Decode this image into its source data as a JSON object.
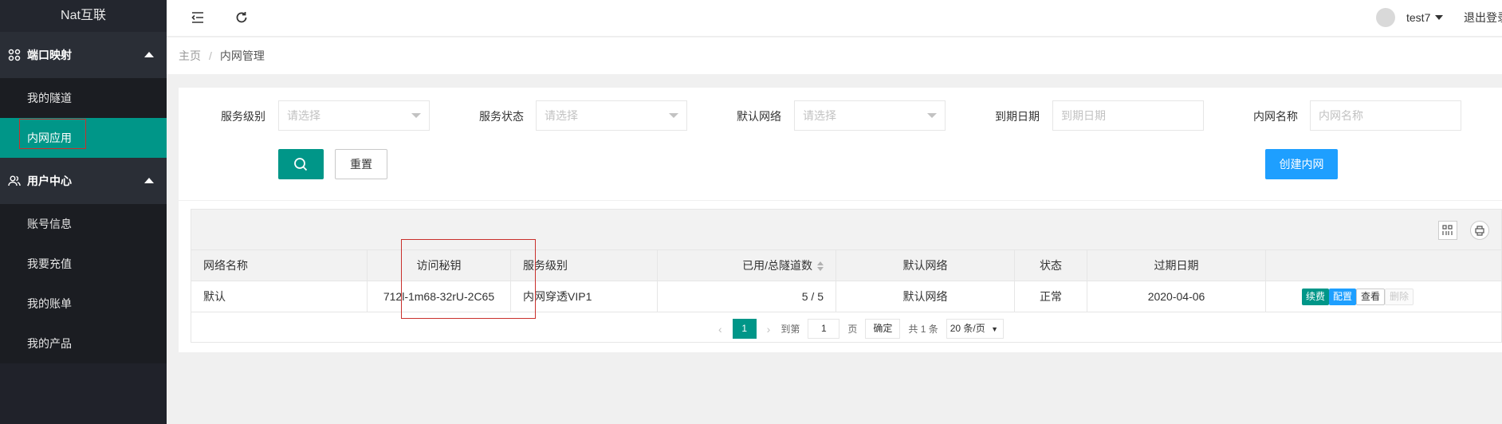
{
  "app": {
    "title": "Nat互联"
  },
  "sidebar": {
    "groups": [
      {
        "label": "端口映射",
        "items": [
          {
            "label": "我的隧道"
          },
          {
            "label": "内网应用",
            "active": true
          }
        ]
      },
      {
        "label": "用户中心",
        "items": [
          {
            "label": "账号信息"
          },
          {
            "label": "我要充值"
          },
          {
            "label": "我的账单"
          },
          {
            "label": "我的产品"
          }
        ]
      }
    ]
  },
  "header": {
    "username": "test7",
    "logout": "退出登录"
  },
  "breadcrumb": {
    "home": "主页",
    "current": "内网管理",
    "separator": "/"
  },
  "filters": {
    "service_level": {
      "label": "服务级别",
      "placeholder": "请选择"
    },
    "service_status": {
      "label": "服务状态",
      "placeholder": "请选择"
    },
    "default_network": {
      "label": "默认网络",
      "placeholder": "请选择"
    },
    "expire_date": {
      "label": "到期日期",
      "placeholder": "到期日期"
    },
    "network_name": {
      "label": "内网名称",
      "placeholder": "内网名称"
    }
  },
  "buttons": {
    "reset": "重置",
    "create": "创建内网"
  },
  "table": {
    "columns": [
      "网络名称",
      "访问秘钥",
      "服务级别",
      "已用/总隧道数",
      "默认网络",
      "状态",
      "过期日期"
    ],
    "rows": [
      {
        "name": "默认",
        "key": "712l-1m68-32rU-2C65",
        "level": "内网穿透VIP1",
        "tunnels": "5 / 5",
        "network": "默认网络",
        "status": "正常",
        "expire": "2020-04-06"
      }
    ],
    "actions": {
      "renew": "续费",
      "config": "配置",
      "view": "查看",
      "delete": "删除"
    }
  },
  "pagination": {
    "current_page": "1",
    "goto_prefix": "到第",
    "goto_value": "1",
    "goto_suffix": "页",
    "confirm": "确定",
    "total": "共 1 条",
    "page_size": "20 条/页"
  },
  "colors": {
    "accent": "#009688",
    "primary": "#1e9fff",
    "sidebar": "#20222a"
  }
}
